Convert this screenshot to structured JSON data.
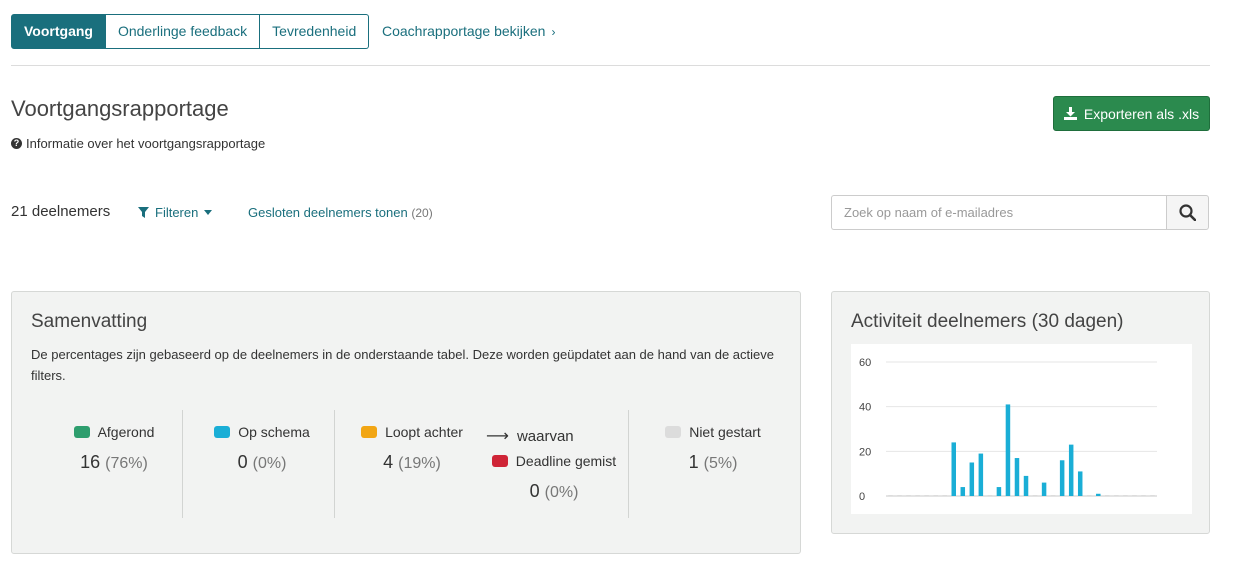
{
  "tabs": [
    {
      "label": "Voortgang",
      "active": true
    },
    {
      "label": "Onderlinge feedback",
      "active": false
    },
    {
      "label": "Tevredenheid",
      "active": false
    }
  ],
  "coach_link": "Coachrapportage bekijken",
  "header": {
    "title": "Voortgangsrapportage",
    "info": "Informatie over het voortgangsrapportage",
    "export_label": "Exporteren als .xls"
  },
  "toolbar": {
    "participant_count": "21 deelnemers",
    "filter_label": "Filteren",
    "closed_label": "Gesloten deelnemers tonen",
    "closed_count": "(20)",
    "search_placeholder": "Zoek op naam of e-mailadres"
  },
  "summary": {
    "title": "Samenvatting",
    "description": "De percentages zijn gebaseerd op de deelnemers in de onderstaande tabel. Deze worden geüpdatet aan de hand van de actieve filters.",
    "stats": [
      {
        "label": "Afgerond",
        "value": "16",
        "pct": "(76%)",
        "color": "#2e9e6e"
      },
      {
        "label": "Op schema",
        "value": "0",
        "pct": "(0%)",
        "color": "#1aaed6"
      },
      {
        "label": "Loopt achter",
        "value": "4",
        "pct": "(19%)",
        "color": "#f2a614"
      },
      {
        "label": "Deadline gemist",
        "value": "0",
        "pct": "(0%)",
        "color": "#cf2436"
      },
      {
        "label": "Niet gestart",
        "value": "1",
        "pct": "(5%)",
        "color": "#dcdcdc"
      }
    ],
    "arrow_label": "waarvan"
  },
  "activity": {
    "title": "Activiteit deelnemers (30 dagen)"
  },
  "chart_data": {
    "type": "bar",
    "title": "Activiteit deelnemers (30 dagen)",
    "ylim": [
      0,
      60
    ],
    "yticks": [
      0,
      20,
      40,
      60
    ],
    "grid": true,
    "bar_color": "#1aaed6",
    "values": [
      0,
      0,
      0,
      0,
      0,
      0,
      0,
      24,
      4,
      15,
      19,
      0,
      4,
      41,
      17,
      9,
      0,
      6,
      0,
      16,
      23,
      11,
      0,
      1,
      0,
      0,
      0,
      0,
      0,
      0
    ]
  }
}
